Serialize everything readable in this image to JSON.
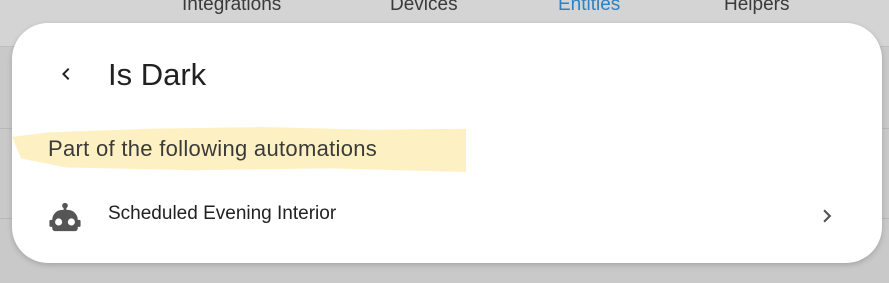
{
  "background": {
    "tabs": [
      {
        "label": "Integrations"
      },
      {
        "label": "Devices"
      },
      {
        "label": "Entities"
      },
      {
        "label": "Helpers"
      }
    ]
  },
  "dialog": {
    "title": "Is Dark",
    "back_icon": "chevron-left-icon",
    "section_heading": "Part of the following automations",
    "automations": [
      {
        "label": "Scheduled Evening Interior",
        "icon": "robot-icon",
        "trailing_icon": "chevron-right-icon"
      }
    ]
  },
  "colors": {
    "accent": "#2b82c4",
    "highlight": "#fdf1c4",
    "icon": "#555555"
  }
}
